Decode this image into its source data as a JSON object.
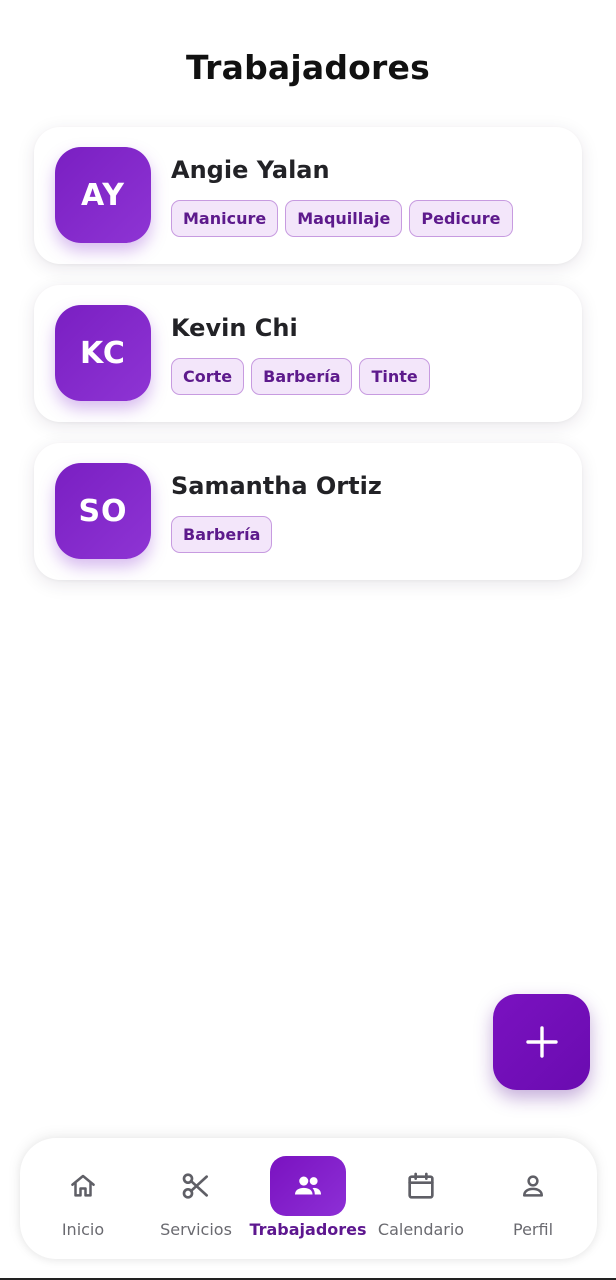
{
  "header": {
    "title": "Trabajadores"
  },
  "workers": [
    {
      "initials": "AY",
      "name": "Angie Yalan",
      "tags": [
        "Manicure",
        "Maquillaje",
        "Pedicure"
      ]
    },
    {
      "initials": "KC",
      "name": "Kevin Chi",
      "tags": [
        "Corte",
        "Barbería",
        "Tinte"
      ]
    },
    {
      "initials": "SO",
      "name": "Samantha Ortiz",
      "tags": [
        "Barbería"
      ]
    }
  ],
  "fab": {
    "icon": "plus-icon"
  },
  "nav": {
    "items": [
      {
        "label": "Inicio",
        "icon": "home-icon",
        "active": false
      },
      {
        "label": "Servicios",
        "icon": "scissors-icon",
        "active": false
      },
      {
        "label": "Trabajadores",
        "icon": "people-icon",
        "active": true
      },
      {
        "label": "Calendario",
        "icon": "calendar-icon",
        "active": false
      },
      {
        "label": "Perfil",
        "icon": "person-icon",
        "active": false
      }
    ]
  },
  "colors": {
    "accent": "#7a12c0",
    "tag_bg": "#f3e6fa",
    "tag_border": "#c79be0",
    "tag_text": "#5d1a8c",
    "nav_active_text": "#5d178f"
  }
}
